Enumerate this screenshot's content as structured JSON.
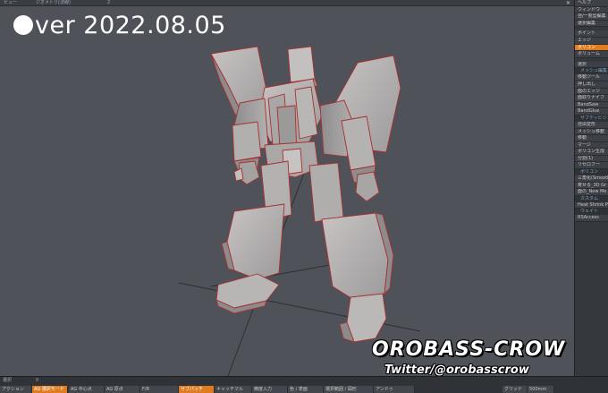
{
  "overlay": {
    "version_text": "ver 2022.08.05"
  },
  "logo": {
    "title": "OROBASS-CROW",
    "subtitle": "Twitter/@orobasscrow"
  },
  "topstrip": {
    "items": [
      "ビュー",
      "ジオメトリ(法線)",
      "2"
    ],
    "close_glyph": "✕"
  },
  "right_panel": {
    "items": [
      {
        "type": "item",
        "label": "ヘルプ"
      },
      {
        "type": "item",
        "label": "ウィンドウ"
      },
      {
        "type": "item",
        "label": "自/一覧型編集"
      },
      {
        "type": "item",
        "label": "選択編集"
      },
      {
        "type": "gap"
      },
      {
        "type": "item",
        "label": "ポイント"
      },
      {
        "type": "item",
        "label": "エッジ"
      },
      {
        "type": "item",
        "label": "ポリゴン",
        "active": true
      },
      {
        "type": "item",
        "label": "ボリューム"
      },
      {
        "type": "gap"
      },
      {
        "type": "item",
        "label": "選択"
      },
      {
        "type": "header",
        "label": "メッシュ編集"
      },
      {
        "type": "item",
        "label": "移動ツール"
      },
      {
        "type": "item",
        "label": "押し出し"
      },
      {
        "type": "item",
        "label": "面のエッジ"
      },
      {
        "type": "item",
        "label": "面取りナイフ"
      },
      {
        "type": "item",
        "label": "BandSaw"
      },
      {
        "type": "item",
        "label": "BandGlue"
      },
      {
        "type": "header",
        "label": "サブディビジョン"
      },
      {
        "type": "item",
        "label": "自由変形"
      },
      {
        "type": "item",
        "label": "メッシュ移動"
      },
      {
        "type": "item",
        "label": "移動"
      },
      {
        "type": "item",
        "label": "マージ"
      },
      {
        "type": "item",
        "label": "ポリゴン生成"
      },
      {
        "type": "item",
        "label": "分割(1)"
      },
      {
        "type": "item",
        "label": "リセロフー"
      },
      {
        "type": "header",
        "label": "ポリゴン"
      },
      {
        "type": "item",
        "label": "三角化(Smoothn"
      },
      {
        "type": "item",
        "label": "寄せる_3D Gr"
      },
      {
        "type": "item",
        "label": "面の_New Me"
      },
      {
        "type": "header",
        "label": "カスタム"
      },
      {
        "type": "item",
        "label": "Heat Shrink P"
      },
      {
        "type": "header",
        "label": "ウェイト"
      },
      {
        "type": "item",
        "label": "RSAccess"
      }
    ]
  },
  "bottom_bar": {
    "status": [
      {
        "label": "選択",
        "x": 3
      },
      {
        "label": "0",
        "x": 40
      }
    ],
    "buttons": [
      {
        "label": "アクション"
      },
      {
        "label": "AG 選択モード",
        "active": true
      },
      {
        "label": "AG 中心点"
      },
      {
        "label": "AG 原点"
      },
      {
        "label": "F/R"
      },
      {
        "label": "サブパッチ",
        "active": true
      },
      {
        "label": "キャッチマル"
      },
      {
        "label": "精度入力"
      },
      {
        "label": "色 / 表面"
      },
      {
        "label": "選択範囲 / 図形"
      },
      {
        "label": "アンドゥ"
      },
      {
        "label": "グリッド"
      },
      {
        "label": "500mm"
      }
    ]
  }
}
